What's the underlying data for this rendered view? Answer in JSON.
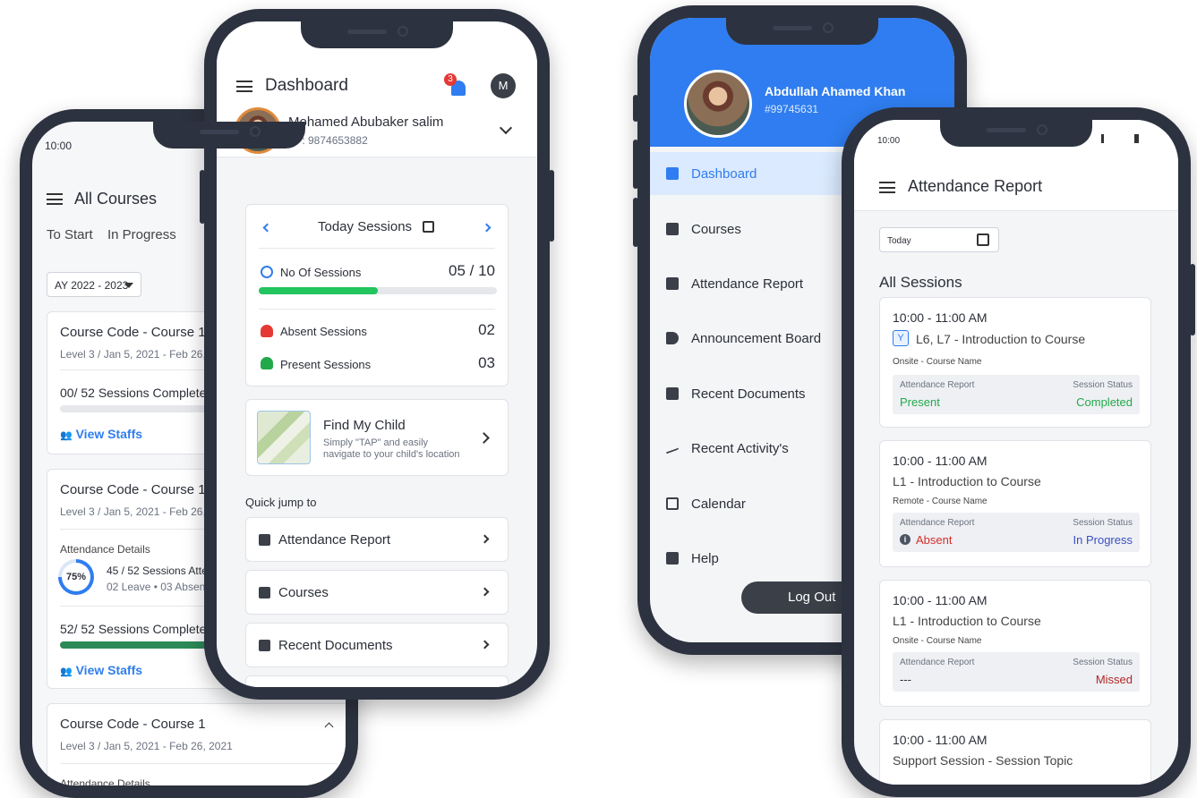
{
  "courses_screen": {
    "time": "10:00",
    "title": "All Courses",
    "tabs": [
      "To Start",
      "In Progress"
    ],
    "year_select": "AY 2022 - 2023",
    "cards": [
      {
        "code": "Course Code - Course 1",
        "meta": "Level 3 / Jan 5, 2021 - Feb 26, 2021",
        "sessions": "00/ 52 Sessions Completed",
        "link": "View Staffs"
      },
      {
        "code": "Course Code - Course 1",
        "meta": "Level 3 / Jan 5, 2021 - Feb 26, 2021",
        "attendance_label": "Attendance Details",
        "percent": "75%",
        "attended": "45 / 52 Sessions Attended",
        "leave": "02 Leave • 03 Absent",
        "sessions": "52/ 52 Sessions Completed",
        "link": "View Staffs"
      },
      {
        "code": "Course Code - Course 1",
        "meta": "Level 3 / Jan 5, 2021 - Feb 26, 2021",
        "attendance_label": "Attendance Details"
      }
    ]
  },
  "dashboard_screen": {
    "title": "Dashboard",
    "notification_count": "3",
    "avatar_letter": "M",
    "user_name": "Mohamed Abubaker salim",
    "user_id": "ID : 9874653882",
    "sessions_title": "Today Sessions",
    "no_of_sessions_label": "No Of Sessions",
    "no_of_sessions_value": "05 / 10",
    "progress": 0.5,
    "absent_label": "Absent Sessions",
    "absent_value": "02",
    "present_label": "Present Sessions",
    "present_value": "03",
    "find_title": "Find My Child",
    "find_desc_1": "Simply \"TAP\" and easily",
    "find_desc_2": "navigate to your child's location",
    "quick_jump": "Quick jump to",
    "quick_items": [
      "Attendance Report",
      "Courses",
      "Recent Documents"
    ]
  },
  "menu_screen": {
    "user_name": "Abdullah Ahamed Khan",
    "user_id": "#99745631",
    "items": [
      "Dashboard",
      "Courses",
      "Attendance Report",
      "Announcement Board",
      "Recent Documents",
      "Recent Activity's",
      "Calendar",
      "Help"
    ],
    "logout": "Log Out"
  },
  "report_screen": {
    "time": "10:00",
    "title": "Attendance Report",
    "date_filter": "Today",
    "section_title": "All Sessions",
    "sessions": [
      {
        "time": "10:00 - 11:00 AM",
        "topic": "L6, L7 - Introduction to Course",
        "mode": "Onsite - Course Name",
        "report_label": "Attendance Report",
        "status_label": "Session Status",
        "report_value": "Present",
        "status_value": "Completed"
      },
      {
        "time": "10:00 - 11:00 AM",
        "topic": "L1 - Introduction to Course",
        "mode": "Remote - Course Name",
        "report_label": "Attendance Report",
        "status_label": "Session Status",
        "report_value": "Absent",
        "status_value": "In Progress"
      },
      {
        "time": "10:00 - 11:00 AM",
        "topic": "L1 - Introduction to Course",
        "mode": "Onsite - Course Name",
        "report_label": "Attendance Report",
        "status_label": "Session Status",
        "report_value": "---",
        "status_value": "Missed"
      },
      {
        "time": "10:00 - 11:00 AM",
        "topic": "Support Session - Session Topic"
      }
    ]
  },
  "colors": {
    "accent": "#2f7df0",
    "frame": "#2d3240",
    "green": "#22a94a",
    "red": "#d62c2c"
  }
}
